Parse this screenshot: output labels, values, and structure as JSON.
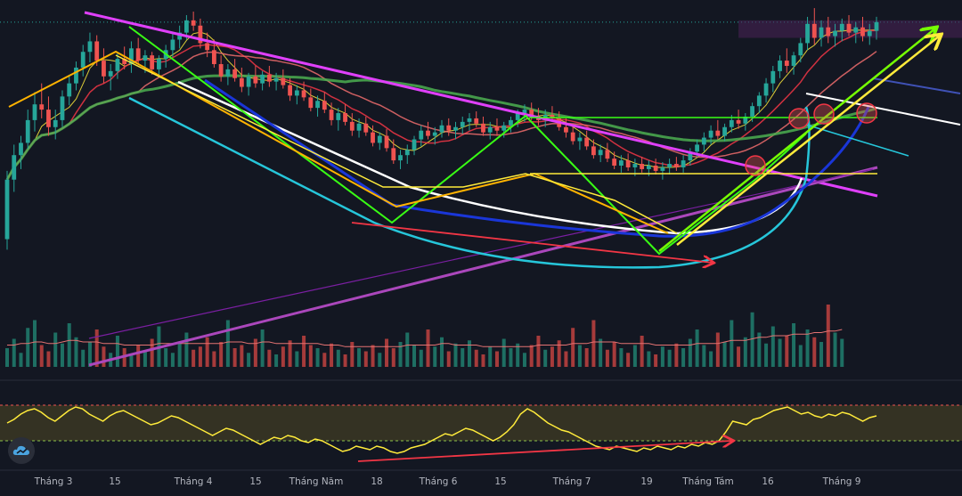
{
  "chart_data": {
    "type": "candlestick",
    "x_tick_labels": [
      "Tháng 3",
      "15",
      "Tháng 4",
      "15",
      "Tháng Năm",
      "18",
      "Tháng 6",
      "15",
      "Tháng 7",
      "19",
      "Tháng Tám",
      "16",
      "Tháng 9"
    ],
    "grid": false,
    "legend": "none",
    "price_panel": {
      "candles": [
        {
          "o": 182,
          "h": 260,
          "l": 170,
          "c": 250
        },
        {
          "o": 250,
          "h": 290,
          "l": 236,
          "c": 278
        },
        {
          "o": 278,
          "h": 300,
          "l": 262,
          "c": 292
        },
        {
          "o": 292,
          "h": 330,
          "l": 285,
          "c": 318
        },
        {
          "o": 318,
          "h": 350,
          "l": 305,
          "c": 336
        },
        {
          "o": 336,
          "h": 360,
          "l": 320,
          "c": 330
        },
        {
          "o": 330,
          "h": 345,
          "l": 300,
          "c": 310
        },
        {
          "o": 310,
          "h": 330,
          "l": 296,
          "c": 318
        },
        {
          "o": 318,
          "h": 352,
          "l": 310,
          "c": 345
        },
        {
          "o": 345,
          "h": 368,
          "l": 335,
          "c": 360
        },
        {
          "o": 360,
          "h": 385,
          "l": 352,
          "c": 378
        },
        {
          "o": 378,
          "h": 404,
          "l": 368,
          "c": 396
        },
        {
          "o": 396,
          "h": 418,
          "l": 384,
          "c": 408
        },
        {
          "o": 408,
          "h": 415,
          "l": 380,
          "c": 386
        },
        {
          "o": 386,
          "h": 400,
          "l": 360,
          "c": 368
        },
        {
          "o": 368,
          "h": 382,
          "l": 352,
          "c": 374
        },
        {
          "o": 374,
          "h": 394,
          "l": 365,
          "c": 388
        },
        {
          "o": 388,
          "h": 402,
          "l": 376,
          "c": 382
        },
        {
          "o": 382,
          "h": 408,
          "l": 372,
          "c": 400
        },
        {
          "o": 400,
          "h": 412,
          "l": 382,
          "c": 386
        },
        {
          "o": 386,
          "h": 398,
          "l": 372,
          "c": 392
        },
        {
          "o": 392,
          "h": 396,
          "l": 370,
          "c": 376
        },
        {
          "o": 376,
          "h": 392,
          "l": 368,
          "c": 388
        },
        {
          "o": 388,
          "h": 404,
          "l": 378,
          "c": 398
        },
        {
          "o": 398,
          "h": 418,
          "l": 390,
          "c": 410
        },
        {
          "o": 410,
          "h": 426,
          "l": 400,
          "c": 418
        },
        {
          "o": 418,
          "h": 438,
          "l": 410,
          "c": 432
        },
        {
          "o": 432,
          "h": 442,
          "l": 420,
          "c": 426
        },
        {
          "o": 426,
          "h": 434,
          "l": 400,
          "c": 406
        },
        {
          "o": 406,
          "h": 418,
          "l": 390,
          "c": 398
        },
        {
          "o": 398,
          "h": 410,
          "l": 378,
          "c": 382
        },
        {
          "o": 382,
          "h": 392,
          "l": 362,
          "c": 368
        },
        {
          "o": 368,
          "h": 382,
          "l": 358,
          "c": 376
        },
        {
          "o": 376,
          "h": 388,
          "l": 362,
          "c": 366
        },
        {
          "o": 366,
          "h": 378,
          "l": 350,
          "c": 356
        },
        {
          "o": 356,
          "h": 372,
          "l": 346,
          "c": 368
        },
        {
          "o": 368,
          "h": 380,
          "l": 355,
          "c": 360
        },
        {
          "o": 360,
          "h": 374,
          "l": 352,
          "c": 370
        },
        {
          "o": 370,
          "h": 380,
          "l": 356,
          "c": 362
        },
        {
          "o": 362,
          "h": 372,
          "l": 352,
          "c": 366
        },
        {
          "o": 366,
          "h": 376,
          "l": 354,
          "c": 358
        },
        {
          "o": 358,
          "h": 366,
          "l": 340,
          "c": 346
        },
        {
          "o": 346,
          "h": 358,
          "l": 336,
          "c": 352
        },
        {
          "o": 352,
          "h": 362,
          "l": 340,
          "c": 344
        },
        {
          "o": 344,
          "h": 354,
          "l": 328,
          "c": 332
        },
        {
          "o": 332,
          "h": 346,
          "l": 322,
          "c": 340
        },
        {
          "o": 340,
          "h": 350,
          "l": 326,
          "c": 330
        },
        {
          "o": 330,
          "h": 338,
          "l": 312,
          "c": 318
        },
        {
          "o": 318,
          "h": 332,
          "l": 306,
          "c": 326
        },
        {
          "o": 326,
          "h": 336,
          "l": 312,
          "c": 316
        },
        {
          "o": 316,
          "h": 326,
          "l": 300,
          "c": 306
        },
        {
          "o": 306,
          "h": 320,
          "l": 298,
          "c": 314
        },
        {
          "o": 314,
          "h": 322,
          "l": 300,
          "c": 304
        },
        {
          "o": 304,
          "h": 312,
          "l": 288,
          "c": 292
        },
        {
          "o": 292,
          "h": 304,
          "l": 284,
          "c": 300
        },
        {
          "o": 300,
          "h": 308,
          "l": 282,
          "c": 286
        },
        {
          "o": 286,
          "h": 296,
          "l": 268,
          "c": 272
        },
        {
          "o": 272,
          "h": 284,
          "l": 262,
          "c": 278
        },
        {
          "o": 278,
          "h": 290,
          "l": 268,
          "c": 284
        },
        {
          "o": 284,
          "h": 300,
          "l": 278,
          "c": 296
        },
        {
          "o": 296,
          "h": 312,
          "l": 288,
          "c": 306
        },
        {
          "o": 306,
          "h": 316,
          "l": 296,
          "c": 300
        },
        {
          "o": 300,
          "h": 310,
          "l": 290,
          "c": 304
        },
        {
          "o": 304,
          "h": 318,
          "l": 298,
          "c": 312
        },
        {
          "o": 312,
          "h": 320,
          "l": 300,
          "c": 306
        },
        {
          "o": 306,
          "h": 316,
          "l": 296,
          "c": 310
        },
        {
          "o": 310,
          "h": 322,
          "l": 302,
          "c": 316
        },
        {
          "o": 316,
          "h": 326,
          "l": 306,
          "c": 320
        },
        {
          "o": 320,
          "h": 328,
          "l": 310,
          "c": 314
        },
        {
          "o": 314,
          "h": 322,
          "l": 300,
          "c": 304
        },
        {
          "o": 304,
          "h": 316,
          "l": 296,
          "c": 310
        },
        {
          "o": 310,
          "h": 320,
          "l": 300,
          "c": 306
        },
        {
          "o": 306,
          "h": 316,
          "l": 298,
          "c": 312
        },
        {
          "o": 312,
          "h": 322,
          "l": 304,
          "c": 318
        },
        {
          "o": 318,
          "h": 330,
          "l": 310,
          "c": 326
        },
        {
          "o": 326,
          "h": 336,
          "l": 316,
          "c": 330
        },
        {
          "o": 330,
          "h": 338,
          "l": 318,
          "c": 322
        },
        {
          "o": 322,
          "h": 332,
          "l": 312,
          "c": 318
        },
        {
          "o": 318,
          "h": 330,
          "l": 310,
          "c": 324
        },
        {
          "o": 324,
          "h": 334,
          "l": 316,
          "c": 320
        },
        {
          "o": 320,
          "h": 328,
          "l": 306,
          "c": 310
        },
        {
          "o": 310,
          "h": 320,
          "l": 298,
          "c": 304
        },
        {
          "o": 304,
          "h": 312,
          "l": 290,
          "c": 294
        },
        {
          "o": 294,
          "h": 304,
          "l": 284,
          "c": 298
        },
        {
          "o": 298,
          "h": 306,
          "l": 284,
          "c": 288
        },
        {
          "o": 288,
          "h": 296,
          "l": 274,
          "c": 278
        },
        {
          "o": 278,
          "h": 290,
          "l": 270,
          "c": 284
        },
        {
          "o": 284,
          "h": 292,
          "l": 270,
          "c": 274
        },
        {
          "o": 274,
          "h": 282,
          "l": 262,
          "c": 266
        },
        {
          "o": 266,
          "h": 278,
          "l": 258,
          "c": 272
        },
        {
          "o": 272,
          "h": 280,
          "l": 260,
          "c": 264
        },
        {
          "o": 264,
          "h": 274,
          "l": 254,
          "c": 268
        },
        {
          "o": 268,
          "h": 276,
          "l": 258,
          "c": 262
        },
        {
          "o": 262,
          "h": 272,
          "l": 254,
          "c": 266
        },
        {
          "o": 266,
          "h": 274,
          "l": 256,
          "c": 260
        },
        {
          "o": 260,
          "h": 270,
          "l": 250,
          "c": 264
        },
        {
          "o": 264,
          "h": 274,
          "l": 256,
          "c": 268
        },
        {
          "o": 268,
          "h": 276,
          "l": 260,
          "c": 264
        },
        {
          "o": 264,
          "h": 278,
          "l": 258,
          "c": 272
        },
        {
          "o": 272,
          "h": 286,
          "l": 266,
          "c": 282
        },
        {
          "o": 282,
          "h": 296,
          "l": 276,
          "c": 290
        },
        {
          "o": 290,
          "h": 304,
          "l": 282,
          "c": 298
        },
        {
          "o": 298,
          "h": 312,
          "l": 290,
          "c": 306
        },
        {
          "o": 306,
          "h": 318,
          "l": 296,
          "c": 300
        },
        {
          "o": 300,
          "h": 314,
          "l": 294,
          "c": 310
        },
        {
          "o": 310,
          "h": 324,
          "l": 304,
          "c": 318
        },
        {
          "o": 318,
          "h": 330,
          "l": 308,
          "c": 314
        },
        {
          "o": 314,
          "h": 326,
          "l": 306,
          "c": 322
        },
        {
          "o": 322,
          "h": 338,
          "l": 316,
          "c": 334
        },
        {
          "o": 334,
          "h": 350,
          "l": 326,
          "c": 346
        },
        {
          "o": 346,
          "h": 366,
          "l": 338,
          "c": 360
        },
        {
          "o": 360,
          "h": 380,
          "l": 350,
          "c": 374
        },
        {
          "o": 374,
          "h": 392,
          "l": 366,
          "c": 386
        },
        {
          "o": 386,
          "h": 400,
          "l": 372,
          "c": 380
        },
        {
          "o": 380,
          "h": 396,
          "l": 370,
          "c": 392
        },
        {
          "o": 392,
          "h": 412,
          "l": 384,
          "c": 406
        },
        {
          "o": 406,
          "h": 436,
          "l": 398,
          "c": 428
        },
        {
          "o": 428,
          "h": 446,
          "l": 404,
          "c": 412
        },
        {
          "o": 412,
          "h": 432,
          "l": 402,
          "c": 424
        },
        {
          "o": 424,
          "h": 436,
          "l": 406,
          "c": 414
        },
        {
          "o": 414,
          "h": 428,
          "l": 402,
          "c": 420
        },
        {
          "o": 420,
          "h": 434,
          "l": 408,
          "c": 428
        },
        {
          "o": 428,
          "h": 438,
          "l": 414,
          "c": 418
        },
        {
          "o": 418,
          "h": 430,
          "l": 406,
          "c": 424
        },
        {
          "o": 424,
          "h": 436,
          "l": 408,
          "c": 414
        },
        {
          "o": 414,
          "h": 428,
          "l": 404,
          "c": 420
        },
        {
          "o": 420,
          "h": 436,
          "l": 410,
          "c": 430
        }
      ]
    },
    "volume_panel": {
      "values": [
        12,
        18,
        9,
        25,
        30,
        14,
        10,
        22,
        15,
        28,
        19,
        11,
        16,
        24,
        13,
        9,
        20,
        12,
        8,
        14,
        10,
        18,
        26,
        12,
        9,
        15,
        22,
        11,
        13,
        19,
        10,
        16,
        30,
        12,
        14,
        9,
        18,
        24,
        11,
        8,
        13,
        17,
        10,
        20,
        14,
        12,
        9,
        15,
        11,
        8,
        16,
        12,
        10,
        14,
        9,
        18,
        12,
        16,
        22,
        14,
        11,
        24,
        13,
        19,
        10,
        15,
        12,
        17,
        11,
        8,
        13,
        10,
        18,
        12,
        15,
        9,
        14,
        20,
        11,
        13,
        17,
        10,
        25,
        14,
        12,
        30,
        18,
        11,
        16,
        12,
        9,
        14,
        20,
        10,
        8,
        13,
        11,
        15,
        12,
        18,
        24,
        14,
        10,
        22,
        16,
        30,
        13,
        19,
        35,
        22,
        15,
        26,
        18,
        20,
        28,
        14,
        24,
        19,
        16,
        40,
        22,
        18
      ],
      "ma_values": [
        14,
        14,
        15,
        15,
        16,
        16,
        15,
        15,
        16,
        17,
        17,
        16,
        16,
        16,
        15,
        15,
        15,
        14,
        14,
        14,
        14,
        14,
        15,
        15,
        15,
        15,
        15,
        15,
        15,
        15,
        15,
        15,
        16,
        16,
        16,
        15,
        15,
        16,
        16,
        15,
        15,
        15,
        15,
        15,
        15,
        15,
        14,
        14,
        14,
        13,
        13,
        13,
        13,
        13,
        13,
        13,
        13,
        13,
        14,
        14,
        14,
        14,
        14,
        15,
        15,
        14,
        14,
        14,
        14,
        13,
        13,
        13,
        13,
        13,
        13,
        13,
        13,
        14,
        14,
        14,
        14,
        14,
        15,
        15,
        15,
        16,
        16,
        16,
        16,
        15,
        15,
        15,
        15,
        15,
        14,
        14,
        14,
        14,
        14,
        14,
        15,
        15,
        15,
        15,
        16,
        17,
        17,
        17,
        18,
        19,
        19,
        20,
        20,
        20,
        21,
        21,
        21,
        22,
        22,
        23,
        23,
        24
      ]
    },
    "rsi_panel": {
      "values": [
        50,
        54,
        60,
        64,
        66,
        62,
        56,
        52,
        58,
        64,
        68,
        66,
        60,
        56,
        52,
        58,
        62,
        64,
        60,
        56,
        52,
        48,
        50,
        54,
        58,
        56,
        52,
        48,
        44,
        40,
        36,
        40,
        44,
        42,
        38,
        34,
        30,
        26,
        30,
        34,
        32,
        36,
        34,
        30,
        28,
        32,
        30,
        26,
        22,
        18,
        20,
        24,
        22,
        20,
        24,
        22,
        18,
        16,
        18,
        22,
        24,
        26,
        30,
        34,
        38,
        36,
        40,
        44,
        42,
        38,
        34,
        30,
        34,
        40,
        48,
        60,
        66,
        62,
        56,
        50,
        46,
        42,
        40,
        36,
        32,
        28,
        24,
        22,
        20,
        24,
        22,
        20,
        18,
        22,
        20,
        24,
        22,
        20,
        24,
        22,
        26,
        24,
        28,
        26,
        30,
        40,
        52,
        50,
        48,
        54,
        56,
        60,
        64,
        66,
        68,
        64,
        60,
        62,
        58,
        56,
        60,
        58,
        62,
        60,
        56,
        52,
        56,
        58
      ]
    },
    "annotations": [
      {
        "kind": "trendline",
        "color": "#e040fb",
        "desc": "descending resistance"
      },
      {
        "kind": "trendline",
        "color": "#ab47bc",
        "desc": "rising support"
      },
      {
        "kind": "cup",
        "color": "#26c6da",
        "desc": "cup curve"
      },
      {
        "kind": "cup",
        "color": "#ffffff",
        "desc": "inner cup curve"
      },
      {
        "kind": "arrow",
        "color": "#ffeb3b",
        "desc": "breakout arrow"
      },
      {
        "kind": "arrow",
        "color": "#76ff03",
        "desc": "breakout arrow"
      },
      {
        "kind": "divergence",
        "color": "#f23645",
        "desc": "price divergence arrow"
      },
      {
        "kind": "divergence",
        "color": "#f23645",
        "desc": "rsi divergence arrow"
      }
    ],
    "colors": {
      "background": "#131722",
      "up": "#26a69a",
      "down": "#ef5350",
      "ma_fast": "#f23645",
      "ma_slow": "#4caf50",
      "ma_long": "#9c27b0",
      "rsi_line": "#ffeb3b",
      "rsi_band": "#3d3a24"
    }
  },
  "icons": {
    "logo": "tradingview-cloud-icon"
  }
}
